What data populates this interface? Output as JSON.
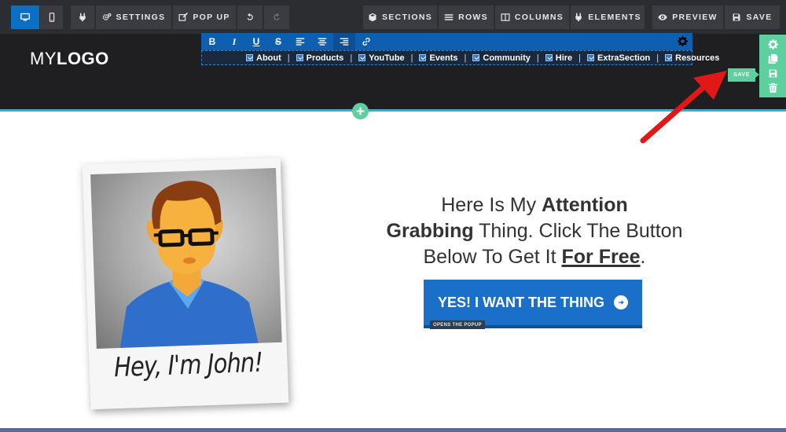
{
  "toolbar": {
    "settings_label": "SETTINGS",
    "popup_label": "POP UP",
    "sections_label": "SECTIONS",
    "rows_label": "ROWS",
    "columns_label": "COLUMNS",
    "elements_label": "ELEMENTS",
    "preview_label": "PREVIEW",
    "save_label": "SAVE"
  },
  "logo": {
    "light": "MY",
    "bold": "LOGO"
  },
  "editor": {
    "bold": "B",
    "italic": "I",
    "underline": "U",
    "strike": "S",
    "nav_items": [
      "About",
      "Products",
      "YouTube",
      "Events",
      "Community",
      "Hire",
      "ExtraSection",
      "Resources"
    ],
    "separator": "|"
  },
  "side_controls": {
    "save_tooltip": "SAVE"
  },
  "content": {
    "headline_1": "Here Is My ",
    "headline_bold_1": "Attention",
    "headline_bold_2": "Grabbing",
    "headline_2": " Thing. Click The Button",
    "headline_3": "Below To Get It ",
    "headline_underline": "For Free",
    "headline_end": ".",
    "cta_label": "YES! I WANT THE THING",
    "cta_tag": "OPENS THE POPUP",
    "caption": "Hey, I'm John!"
  },
  "colors": {
    "toolbar_bg": "#2b2d31",
    "active_blue": "#0d6fc4",
    "editor_blue": "#0f5fb0",
    "accent_green": "#5ecf9f",
    "accent_cyan": "#2fb1d6",
    "cta_blue": "#1a6fc8",
    "annotation_red": "#e01818"
  }
}
